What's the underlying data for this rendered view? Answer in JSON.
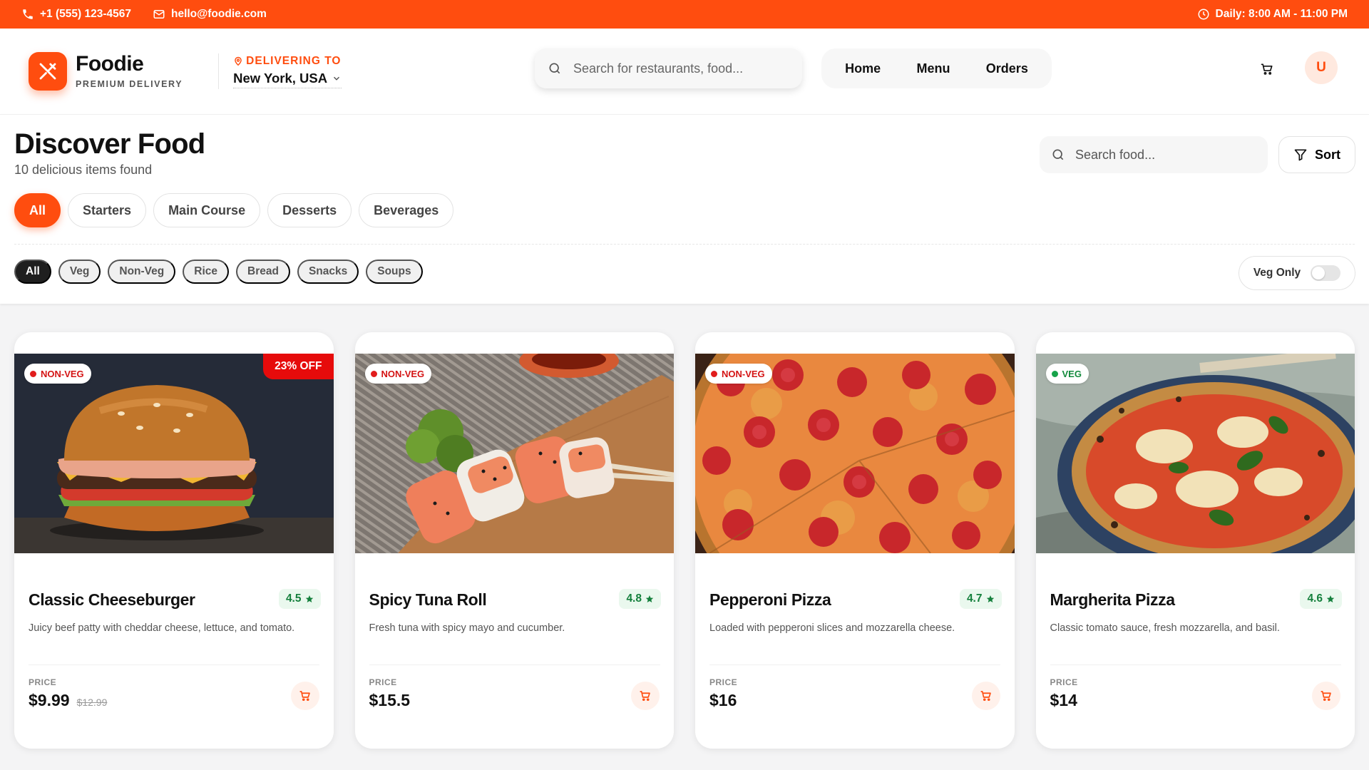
{
  "topbar": {
    "phone": "+1 (555) 123-4567",
    "email": "hello@foodie.com",
    "hours": "Daily: 8:00 AM - 11:00 PM"
  },
  "brand": {
    "name": "Foodie",
    "tagline": "PREMIUM DELIVERY",
    "accent": "#ff4d0f"
  },
  "delivery": {
    "label": "DELIVERING TO",
    "location": "New York, USA"
  },
  "header_search": {
    "placeholder": "Search for restaurants, food..."
  },
  "nav": {
    "home": "Home",
    "menu": "Menu",
    "orders": "Orders"
  },
  "user": {
    "initial": "U"
  },
  "page": {
    "title": "Discover Food",
    "subtitle": "10 delicious items found",
    "search_placeholder": "Search food...",
    "sort_label": "Sort"
  },
  "categories": [
    "All",
    "Starters",
    "Main Course",
    "Desserts",
    "Beverages"
  ],
  "sub_filters": [
    "All",
    "Veg",
    "Non-Veg",
    "Rice",
    "Bread",
    "Snacks",
    "Soups"
  ],
  "veg_only": {
    "label": "Veg Only",
    "enabled": false
  },
  "cards": [
    {
      "badge": "NON-VEG",
      "discount": "23% OFF",
      "title": "Classic Cheeseburger",
      "rating": "4.5",
      "description": "Juicy beef patty with cheddar cheese, lettuce, and tomato.",
      "price_label": "PRICE",
      "price": "$9.99",
      "old_price": "$12.99",
      "image_icon": "burger-image"
    },
    {
      "badge": "NON-VEG",
      "title": "Spicy Tuna Roll",
      "rating": "4.8",
      "description": "Fresh tuna with spicy mayo and cucumber.",
      "price_label": "PRICE",
      "price": "$15.5",
      "image_icon": "sushi-image"
    },
    {
      "badge": "NON-VEG",
      "title": "Pepperoni Pizza",
      "rating": "4.7",
      "description": "Loaded with pepperoni slices and mozzarella cheese.",
      "price_label": "PRICE",
      "price": "$16",
      "image_icon": "pepperoni-pizza-image"
    },
    {
      "badge": "VEG",
      "title": "Margherita Pizza",
      "rating": "4.6",
      "description": "Classic tomato sauce, fresh mozzarella, and basil.",
      "price_label": "PRICE",
      "price": "$14",
      "image_icon": "margherita-pizza-image"
    }
  ]
}
